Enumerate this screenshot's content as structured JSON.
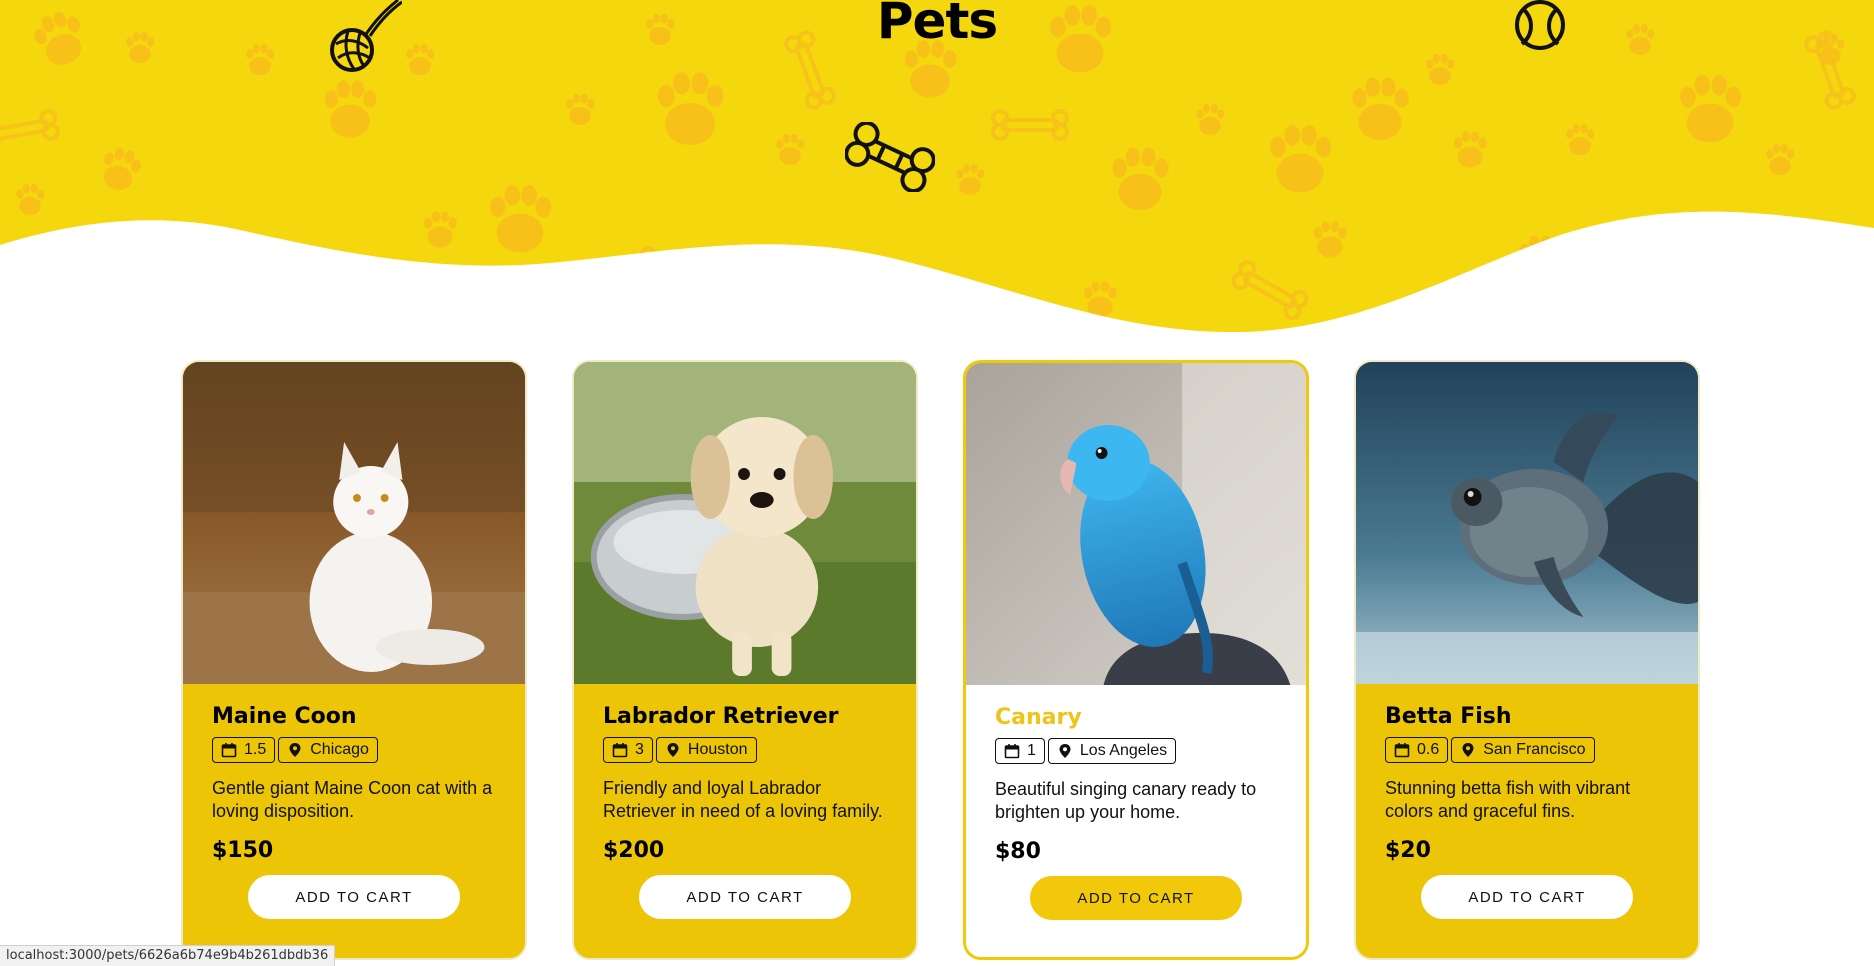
{
  "page": {
    "title": "Pets",
    "colors": {
      "hero_yellow": "#f4d70d",
      "paw_orange": "#f8bf1c",
      "card_yellow": "#ecc506",
      "accent": "#f2c90a"
    }
  },
  "decorations": [
    "yarn-ball-icon",
    "bone-toy-icon",
    "tennis-ball-icon",
    "paw-print-icon",
    "bone-icon"
  ],
  "pets": [
    {
      "name": "Maine Coon",
      "age": "1.5",
      "location": "Chicago",
      "description": "Gentle giant Maine Coon cat with a loving disposition.",
      "price": "$150",
      "button_label": "ADD TO CART",
      "image": "white-cat-photo",
      "selected": false
    },
    {
      "name": "Labrador Retriever",
      "age": "3",
      "location": "Houston",
      "description": "Friendly and loyal Labrador Retriever in need of a loving family.",
      "price": "$200",
      "button_label": "ADD TO CART",
      "image": "golden-puppy-photo",
      "selected": false
    },
    {
      "name": "Canary",
      "age": "1",
      "location": "Los Angeles",
      "description": "Beautiful singing canary ready to brighten up your home.",
      "price": "$80",
      "button_label": "ADD TO CART",
      "image": "blue-parakeet-photo",
      "selected": true
    },
    {
      "name": "Betta Fish",
      "age": "0.6",
      "location": "San Francisco",
      "description": "Stunning betta fish with vibrant colors and graceful fins.",
      "price": "$20",
      "button_label": "ADD TO CART",
      "image": "goldfish-photo",
      "selected": false
    }
  ],
  "status_bar": {
    "url": "localhost:3000/pets/6626a6b74e9b4b261dbdb36"
  }
}
